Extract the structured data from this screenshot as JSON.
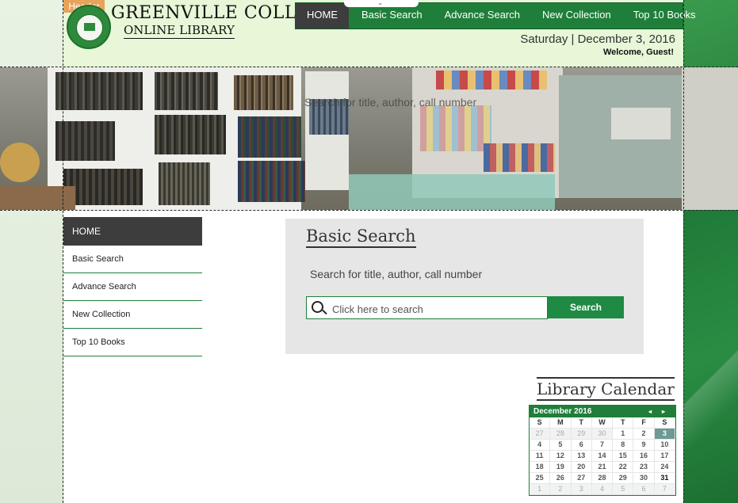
{
  "header": {
    "tag": "Header",
    "logo_title": "GREENVILLE COLLEGE",
    "logo_subtitle": "ONLINE LIBRARY",
    "date": "Saturday | December 3, 2016",
    "welcome": "Welcome, Guest!"
  },
  "topnav": {
    "items": [
      {
        "label": "HOME",
        "active": true
      },
      {
        "label": "Basic Search"
      },
      {
        "label": "Advance Search"
      },
      {
        "label": "New Collection"
      },
      {
        "label": "Top 10 Books"
      }
    ]
  },
  "banner": {
    "overlay_text": "Search for title, author, call number"
  },
  "sidenav": {
    "items": [
      {
        "label": "HOME",
        "active": true
      },
      {
        "label": "Basic Search"
      },
      {
        "label": "Advance Search"
      },
      {
        "label": "New Collection"
      },
      {
        "label": "Top 10 Books"
      }
    ]
  },
  "search": {
    "title": "Basic Search",
    "label": "Search for title, author, call number",
    "placeholder": "Click here to search",
    "button": "Search",
    "icon": "search-icon"
  },
  "calendar": {
    "title": "Library Calendar",
    "month": "December 2016",
    "prev_glyph": "◂",
    "next_glyph": "▸",
    "weekdays": [
      "S",
      "M",
      "T",
      "W",
      "T",
      "F",
      "S"
    ],
    "days": [
      "27",
      "28",
      "29",
      "30",
      "1",
      "2",
      "3",
      "4",
      "5",
      "6",
      "7",
      "8",
      "9",
      "10",
      "11",
      "12",
      "13",
      "14",
      "15",
      "16",
      "17",
      "18",
      "19",
      "20",
      "21",
      "22",
      "23",
      "24",
      "25",
      "26",
      "27",
      "28",
      "29",
      "30",
      "31",
      "1",
      "2",
      "3",
      "4",
      "5",
      "6",
      "7"
    ],
    "colors": {
      "accent": "#1f7f3a",
      "today": "#6f9a94"
    }
  }
}
